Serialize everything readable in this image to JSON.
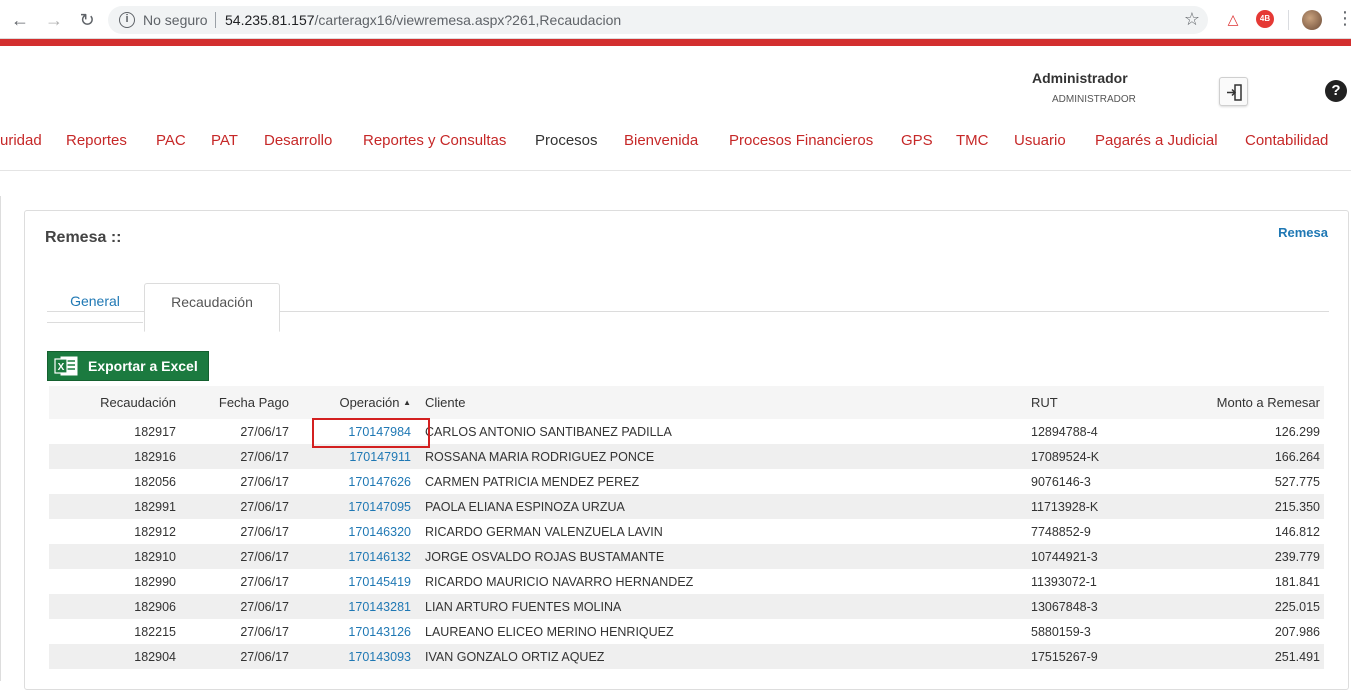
{
  "browser": {
    "security_label": "No seguro",
    "url_host": "54.235.81.157",
    "url_path": "/carteragx16/viewremesa.aspx?261,Recaudacion",
    "ext_red_label": "4B"
  },
  "header": {
    "user_name": "Administrador",
    "user_role": "ADMINISTRADOR",
    "help_label": "?"
  },
  "menu": {
    "items": [
      "uridad",
      "Reportes",
      "PAC",
      "PAT",
      "Desarrollo",
      "Reportes y Consultas",
      "Procesos",
      "Bienvenida",
      "Procesos Financieros",
      "GPS",
      "TMC",
      "Usuario",
      "Pagarés a Judicial",
      "Contabilidad"
    ]
  },
  "panel": {
    "title": "Remesa ::",
    "link": "Remesa",
    "tabs": [
      "General",
      "Recaudación"
    ],
    "excel_label": "Exportar a Excel"
  },
  "table": {
    "headers": [
      "Recaudación",
      "Fecha Pago",
      "Operación",
      "Cliente",
      "RUT",
      "Monto a Remesar"
    ],
    "sort_indicator": "▲",
    "rows": [
      [
        "182917",
        "27/06/17",
        "170147984",
        "CARLOS ANTONIO SANTIBANEZ PADILLA",
        "12894788-4",
        "126.299"
      ],
      [
        "182916",
        "27/06/17",
        "170147911",
        "ROSSANA MARIA RODRIGUEZ PONCE",
        "17089524-K",
        "166.264"
      ],
      [
        "182056",
        "27/06/17",
        "170147626",
        "CARMEN PATRICIA MENDEZ PEREZ",
        "9076146-3",
        "527.775"
      ],
      [
        "182991",
        "27/06/17",
        "170147095",
        "PAOLA ELIANA ESPINOZA URZUA",
        "11713928-K",
        "215.350"
      ],
      [
        "182912",
        "27/06/17",
        "170146320",
        "RICARDO GERMAN VALENZUELA LAVIN",
        "7748852-9",
        "146.812"
      ],
      [
        "182910",
        "27/06/17",
        "170146132",
        "JORGE OSVALDO ROJAS BUSTAMANTE",
        "10744921-3",
        "239.779"
      ],
      [
        "182990",
        "27/06/17",
        "170145419",
        "RICARDO MAURICIO NAVARRO HERNANDEZ",
        "11393072-1",
        "181.841"
      ],
      [
        "182906",
        "27/06/17",
        "170143281",
        "LIAN ARTURO FUENTES MOLINA",
        "13067848-3",
        "225.015"
      ],
      [
        "182215",
        "27/06/17",
        "170143126",
        "LAUREANO ELICEO MERINO HENRIQUEZ",
        "5880159-3",
        "207.986"
      ],
      [
        "182904",
        "27/06/17",
        "170143093",
        "IVAN GONZALO ORTIZ AQUEZ",
        "17515267-9",
        "251.491"
      ]
    ]
  },
  "colors": {
    "brand_red": "#d32f2f",
    "menu_red": "#c62828",
    "link_blue": "#1f78b4",
    "excel_green": "#1b7a3f"
  }
}
